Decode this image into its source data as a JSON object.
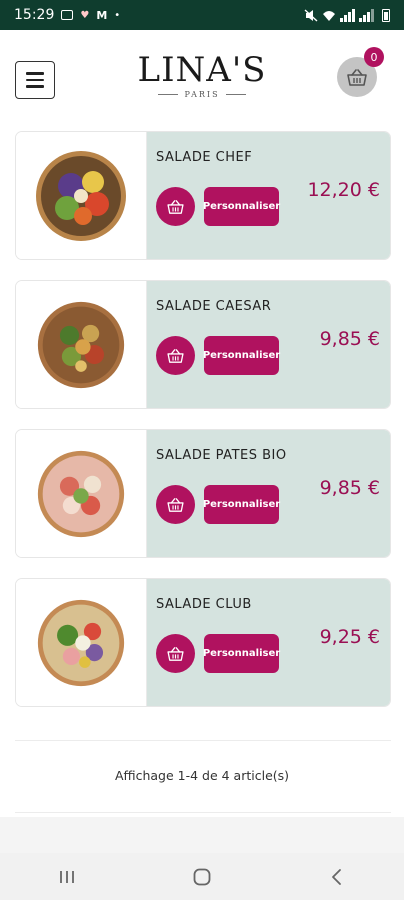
{
  "status_bar": {
    "time": "15:29"
  },
  "header": {
    "logo_main": "LINA'S",
    "logo_sub": "PARIS",
    "cart_count": "0"
  },
  "products": [
    {
      "name": "SALADE CHEF",
      "price": "12,20 €",
      "customize_label": "Personnaliser"
    },
    {
      "name": "SALADE CAESAR",
      "price": "9,85 €",
      "customize_label": "Personnaliser"
    },
    {
      "name": "SALADE PATES BIO",
      "price": "9,85 €",
      "customize_label": "Personnaliser"
    },
    {
      "name": "SALADE CLUB",
      "price": "9,25 €",
      "customize_label": "Personnaliser"
    }
  ],
  "pagination": {
    "text": "Affichage 1-4 de 4 article(s)"
  },
  "colors": {
    "accent": "#b0125f",
    "price": "#9a0f53",
    "card_bg": "#d5e3df",
    "status_bar": "#0f3d2e"
  }
}
